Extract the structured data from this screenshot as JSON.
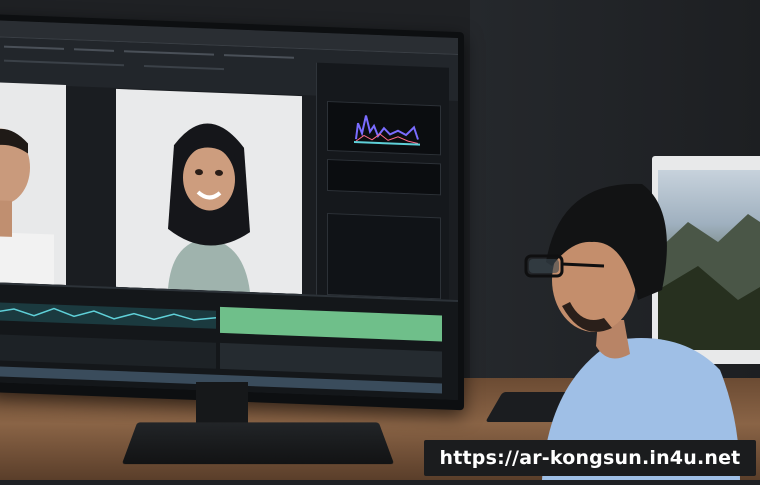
{
  "scene": {
    "description_tags": [
      "video-editor-monitor",
      "person-at-desk",
      "second-monitor"
    ]
  },
  "watermark": {
    "text": "https://ar-kongsun.in4u.net"
  },
  "colors": {
    "timeline_green": "#6fbf8a",
    "waveform_cyan": "#5fd0d8",
    "scope_purple": "#7a6cff",
    "shirt_blue": "#9fbfe6"
  }
}
